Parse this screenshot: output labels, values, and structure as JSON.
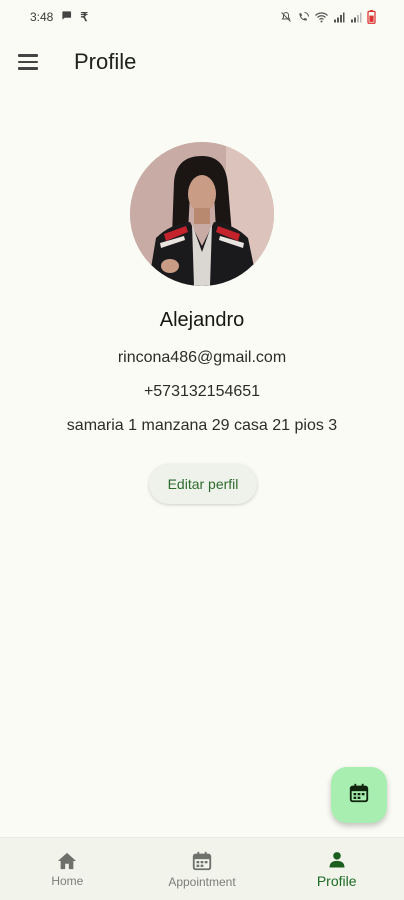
{
  "status_bar": {
    "time": "3:48",
    "left_icons": [
      "chat-bubble-icon",
      "rupee-icon"
    ],
    "right_icons": [
      "mute-icon",
      "wifi-calling-icon",
      "wifi-icon",
      "signal-icon",
      "signal-icon",
      "battery-icon"
    ]
  },
  "app_bar": {
    "menu_icon": "menu-icon",
    "title": "Profile"
  },
  "profile": {
    "name": "Alejandro",
    "email": "rincona486@gmail.com",
    "phone": "+573132154651",
    "address": "samaria 1 manzana 29 casa 21 pios 3",
    "edit_label": "Editar perfil"
  },
  "fab": {
    "icon": "calendar-icon",
    "color": "#a8eeb0"
  },
  "bottom_nav": {
    "items": [
      {
        "label": "Home",
        "icon": "home-icon"
      },
      {
        "label": "Appointment",
        "icon": "calendar-icon"
      },
      {
        "label": "Profile",
        "icon": "person-icon"
      }
    ],
    "active_index": 2,
    "active_color": "#1b6b22"
  }
}
